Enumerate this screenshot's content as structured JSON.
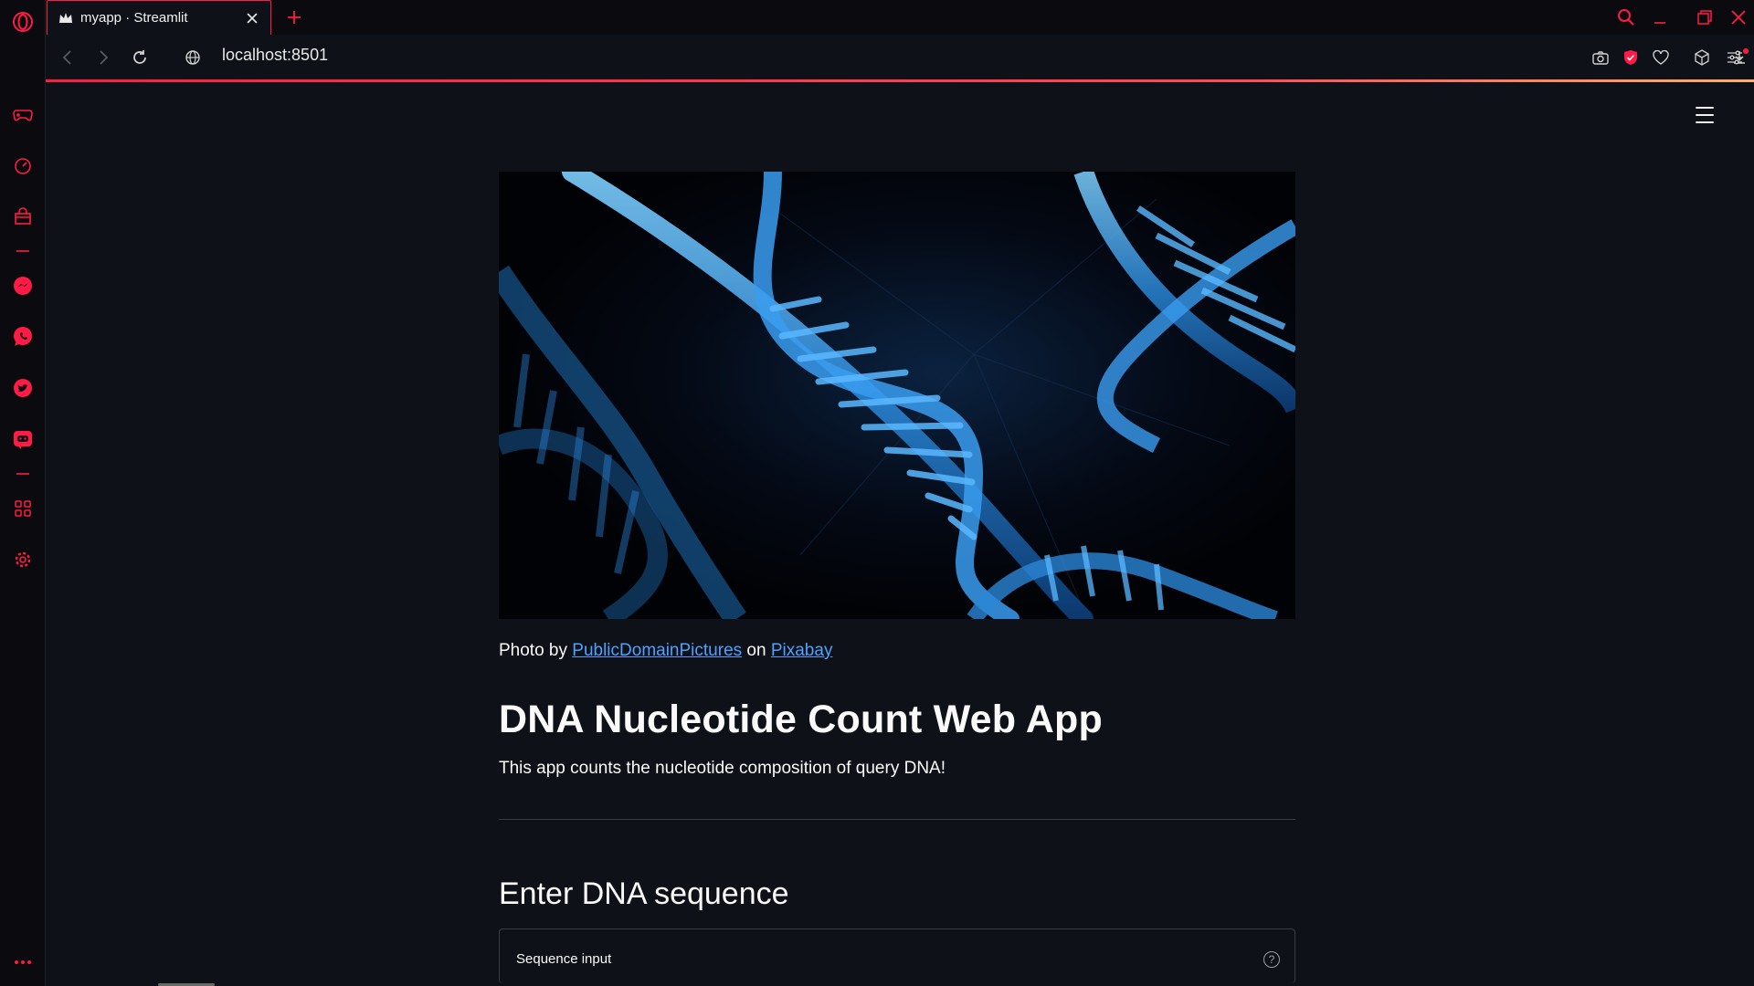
{
  "browser": {
    "tab": {
      "title": "myapp · Streamlit",
      "favicon": "streamlit-crown-icon"
    },
    "url": "localhost:8501",
    "accent": "#ff1b45"
  },
  "sidebar": {
    "icons": [
      "opera-logo-icon",
      "gamepad-icon",
      "speedometer-icon",
      "bag-icon",
      "messenger-icon",
      "whatsapp-icon",
      "twitter-icon",
      "discord-icon",
      "extensions-grid-icon",
      "settings-icon",
      "more-icon"
    ]
  },
  "app": {
    "credit": {
      "prefix": "Photo by ",
      "author": "PublicDomainPictures",
      "mid": " on ",
      "site": "Pixabay"
    },
    "title": "DNA Nucleotide Count Web App",
    "subtitle": "This app counts the nucleotide composition of query DNA!",
    "section_header": "Enter DNA sequence",
    "input_label": "Sequence input",
    "help_glyph": "?"
  },
  "colors": {
    "background": "#0e1117",
    "link": "#4ea1ff",
    "text": "#fafafa",
    "dna": "#2e8fe0"
  }
}
